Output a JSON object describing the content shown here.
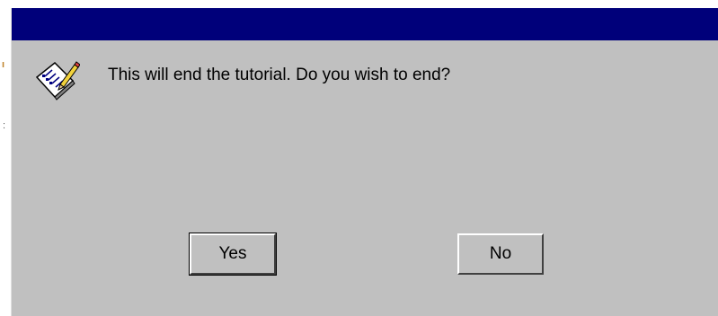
{
  "dialog": {
    "message": "This will end the tutorial. Do you wish to end?",
    "icon": "notepad-pencil-icon",
    "buttons": {
      "yes_label": "Yes",
      "no_label": "No"
    },
    "colors": {
      "titlebar": "#00007a",
      "body": "#c0c0c0"
    }
  }
}
